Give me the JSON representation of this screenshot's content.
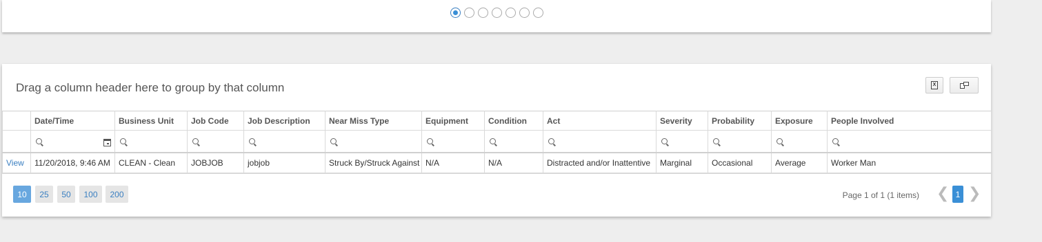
{
  "carousel": {
    "total": 7,
    "active": 0
  },
  "grid": {
    "group_panel_text": "Drag a column header here to group by that column",
    "export_excel_icon": "excel-icon",
    "column_chooser_icon": "column-chooser-icon",
    "columns": [
      "",
      "Date/Time",
      "Business Unit",
      "Job Code",
      "Job Description",
      "Near Miss Type",
      "Equipment",
      "Condition",
      "Act",
      "Severity",
      "Probability",
      "Exposure",
      "People Involved"
    ],
    "rows": [
      {
        "view": "View",
        "date_time": "11/20/2018, 9:46 AM",
        "business_unit": "CLEAN - Clean",
        "job_code": "JOBJOB",
        "job_description": "jobjob",
        "near_miss_type": "Struck By/Struck Against",
        "equipment": "N/A",
        "condition": "N/A",
        "act": "Distracted and/or Inattentive",
        "severity": "Marginal",
        "probability": "Occasional",
        "exposure": "Average",
        "people_involved": "Worker Man"
      }
    ]
  },
  "pager": {
    "sizes": [
      "10",
      "25",
      "50",
      "100",
      "200"
    ],
    "active_size": "10",
    "info": "Page 1 of 1 (1 items)",
    "current_page": "1",
    "prev_glyph": "❮",
    "next_glyph": "❯"
  },
  "colors": {
    "accent": "#3a8fd6",
    "active_size_bg": "#68a7df",
    "link": "#3a7fc1"
  }
}
